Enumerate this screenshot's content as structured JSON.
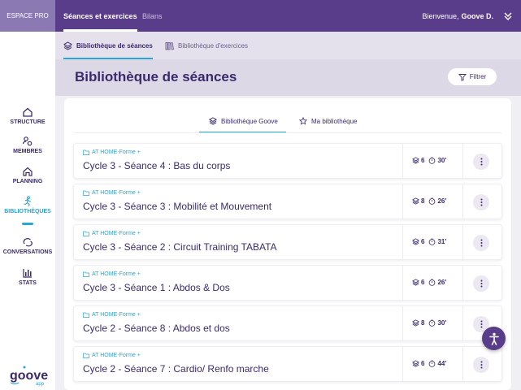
{
  "topbar": {
    "espace_label": "ESPACE PRO",
    "tabs": [
      {
        "label": "Séances et exercices",
        "active": true
      },
      {
        "label": "Bilans",
        "active": false
      }
    ],
    "welcome_text": "Bienvenue,",
    "user_name": "Goove D."
  },
  "subnav": {
    "tabs": [
      {
        "label": "Bibliothèque de séances",
        "active": true,
        "icon": "layers-icon"
      },
      {
        "label": "Bibliothèque d'exercices",
        "active": false,
        "icon": "books-icon"
      }
    ]
  },
  "sidebar": {
    "items": [
      {
        "label": "STRUCTURE",
        "icon": "house-icon"
      },
      {
        "label": "MEMBRES",
        "icon": "members-icon"
      },
      {
        "label": "PLANNING",
        "icon": "planning-icon"
      },
      {
        "label": "BIBLIOTHÈQUES",
        "icon": "runner-icon",
        "active": true
      },
      {
        "label": "CONVERSATIONS",
        "icon": "chat-icon"
      },
      {
        "label": "STATS",
        "icon": "stats-icon"
      }
    ],
    "logo_text": "goove",
    "logo_sub": "app"
  },
  "page": {
    "title": "Bibliothèque de séances",
    "filter_label": "Filtrer"
  },
  "library_tabs": [
    {
      "label": "Bibliothèque Goove",
      "active": true
    },
    {
      "label": "Ma bibliothèque",
      "active": false
    }
  ],
  "sessions": [
    {
      "folder": "AT HOME-Forme +",
      "title": "Cycle 3 - Séance 4 : Bas du corps",
      "count": "6",
      "duration": "30'"
    },
    {
      "folder": "AT HOME-Forme +",
      "title": "Cycle 3 - Séance 3 : Mobilité et Mouvement",
      "count": "8",
      "duration": "26'"
    },
    {
      "folder": "AT HOME-Forme +",
      "title": "Cycle 3 - Séance 2 : Circuit Training TABATA",
      "count": "6",
      "duration": "31'"
    },
    {
      "folder": "AT HOME-Forme +",
      "title": "Cycle 3 - Séance 1 : Abdos & Dos",
      "count": "6",
      "duration": "26'"
    },
    {
      "folder": "AT HOME-Forme +",
      "title": "Cycle 2 - Séance 8 : Abdos et dos",
      "count": "8",
      "duration": "30'"
    },
    {
      "folder": "AT HOME-Forme +",
      "title": "Cycle 2 - Séance 7 : Cardio/ Renfo marche",
      "count": "6",
      "duration": "44'"
    }
  ],
  "colors": {
    "brand_purple": "#5a3d8a",
    "accent_blue": "#29a6d6",
    "text_dark": "#3b2a6b"
  }
}
